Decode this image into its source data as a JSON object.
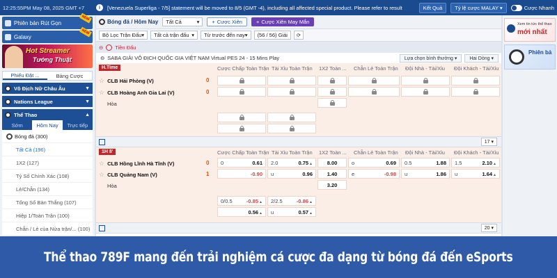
{
  "topbar": {
    "time": "12:25:55PM May 08, 2025 GMT +7",
    "ticker": "[Venezuela Superliga - 7/5] statement will be moved to 8/5 (GMT -4), including all affected special product. Please refer to result",
    "result_button": "Kết Quả",
    "odds_type": "Tỷ lệ cược MALAY",
    "quick_bet": "Cược Nhanh"
  },
  "sidebar": {
    "live_button": "Phiên bản Rút Gọn",
    "galaxy_button": "Galaxy",
    "banner_line1": "Hot Streamer",
    "banner_line2": "Tướng Thuật",
    "subtabs": [
      "Phiếu Đặt ...",
      "Bảng Cược"
    ],
    "cat1": "Vô Địch Nữ Châu Âu",
    "cat2": "Nations League",
    "cat3": "Thể Thao",
    "tabs": [
      "Sớm",
      "Hôm Nay",
      "Trực tiếp"
    ],
    "sport_head": "Bóng đá  (300)",
    "items": [
      "Tất Cả  (196)",
      "1X2  (127)",
      "Tỷ Số Chính Xác  (108)",
      "Lẻ/Chẵn  (134)",
      "Tổng Số Bàn Thắng  (107)",
      "Hiệp 1/Toàn Trận  (100)",
      "Chẵn / Lẻ của Nửa trận/...  (100)"
    ]
  },
  "main": {
    "sport_title": "Bóng đá / Hôm Nay",
    "all_select": "Tất Cả",
    "bet_pill": "Cược Xiên",
    "bet_lucky_pill": "Cược Xiên May Mắn",
    "league_filter": "Bộ Lọc Trận Đấu",
    "all_matches": "Tất cả trận đấu",
    "sort_select": "Từ trước đến nay",
    "count": "(56 / 56) Giải",
    "section_title": "Tiền Đấu",
    "league_name": "SABA GIẢI VÔ ĐỊCH QUỐC GIA VIỆT NAM Virtual PES 24 - 15 Mins Play",
    "sort_normal": "Lựa chọn bình thường",
    "double_line": "Hai Dòng",
    "columns": [
      "Cược Chấp Toàn Trận",
      "Tài Xỉu Toàn Trận",
      "1X2 Toàn ...",
      "Chẵn Lẻ Toàn Trận",
      "Đội Nhà - Tài/Xỉu",
      "Đội Khách - Tài/Xỉu"
    ],
    "match1": {
      "tag": "H.Time",
      "home": "CLB Hải Phòng (V)",
      "away": "CLB Hoàng Anh Gia Lai (V)",
      "home_score": "0",
      "away_score": "0",
      "draw": "Hòa"
    },
    "footer1_count": "17",
    "match2": {
      "tag": "1H  8'",
      "home": "CLB Hồng Lĩnh Hà Tĩnh (V)",
      "away": "CLB Quảng Nam (V)",
      "home_score": "0",
      "away_score": "1",
      "draw": "Hòa",
      "r1": {
        "hdp_line": "0",
        "hdp_odds": "0.61",
        "ou_line": "2.0",
        "ou_odds": "0.75",
        "x12": "8.00",
        "oe_label": "o",
        "oe_odds": "0.69",
        "home_ou_line": "0.5",
        "home_ou_odds": "1.88",
        "away_ou_line": "1.5",
        "away_ou_odds": "2.10"
      },
      "r2": {
        "hdp_odds": "-0.90",
        "ou_label": "u",
        "ou_odds": "0.96",
        "x12": "1.40",
        "oe_label": "e",
        "oe_odds": "-0.98",
        "home_ou_label": "u",
        "home_ou_odds": "1.86",
        "away_ou_label": "u",
        "away_ou_odds": "1.64"
      },
      "r3": {
        "x12": "3.20"
      },
      "r4": {
        "hdp_line": "0/0.5",
        "hdp_odds": "-0.85",
        "ou_line": "2/2.5",
        "ou_odds": "-0.86"
      },
      "r5": {
        "hdp_odds": "0.56",
        "ou_label": "u",
        "ou_odds": "0.57"
      }
    },
    "footer2_count": "20"
  },
  "right": {
    "promo_small": "Xem tin tức thể thao",
    "promo_big": "mới nhất",
    "promo2": "Phiên bả"
  },
  "caption": "Thể thao 789F mang đến trải nghiệm cá cược đa dạng từ bóng đá đến eSports",
  "colors": {
    "primary": "#1b4b8f",
    "live_red": "#c0272d",
    "negative": "#e53935",
    "caption_bg": "#2f5aa8"
  }
}
